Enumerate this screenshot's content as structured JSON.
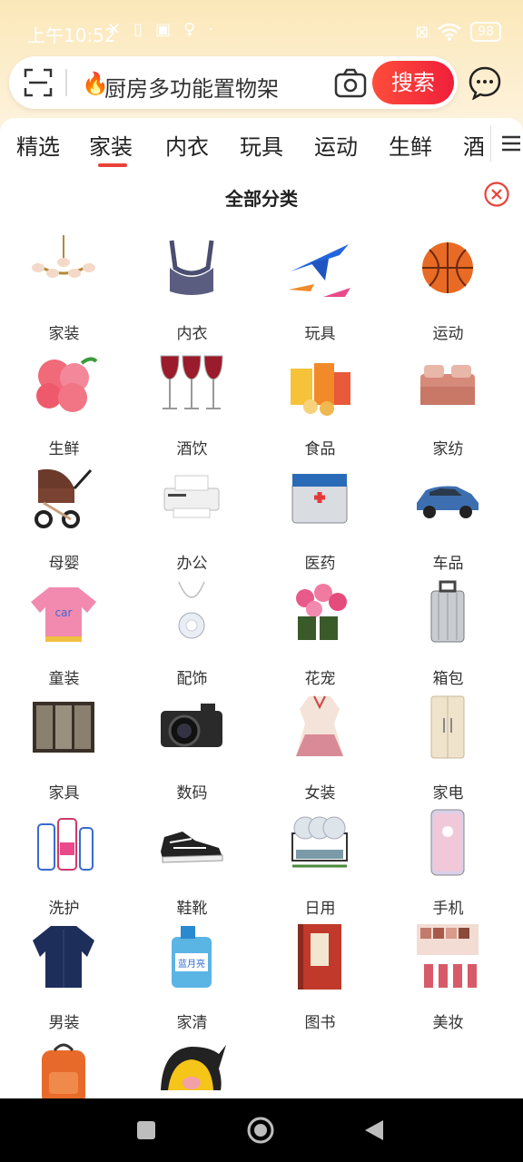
{
  "status": {
    "time": "上午10:52",
    "battery": "98"
  },
  "search": {
    "query": "厨房多功能置物架",
    "button_label": "搜索"
  },
  "tabs": [
    "精选",
    "家装",
    "内衣",
    "玩具",
    "运动",
    "生鲜",
    "酒"
  ],
  "panel": {
    "title": "全部分类"
  },
  "categories": [
    {
      "label": "家装",
      "icon": "chandelier-icon"
    },
    {
      "label": "内衣",
      "icon": "bra-icon"
    },
    {
      "label": "玩具",
      "icon": "toy-plane-icon"
    },
    {
      "label": "运动",
      "icon": "basketball-icon"
    },
    {
      "label": "生鲜",
      "icon": "peach-icon"
    },
    {
      "label": "酒饮",
      "icon": "wine-glass-icon"
    },
    {
      "label": "食品",
      "icon": "snack-icon"
    },
    {
      "label": "家纺",
      "icon": "bed-icon"
    },
    {
      "label": "母婴",
      "icon": "stroller-icon"
    },
    {
      "label": "办公",
      "icon": "printer-icon"
    },
    {
      "label": "医药",
      "icon": "medicine-box-icon"
    },
    {
      "label": "车品",
      "icon": "car-icon"
    },
    {
      "label": "童装",
      "icon": "kids-sweater-icon"
    },
    {
      "label": "配饰",
      "icon": "necklace-icon"
    },
    {
      "label": "花宠",
      "icon": "flower-pot-icon"
    },
    {
      "label": "箱包",
      "icon": "suitcase-icon"
    },
    {
      "label": "家具",
      "icon": "wardrobe-icon"
    },
    {
      "label": "数码",
      "icon": "camera-icon"
    },
    {
      "label": "女装",
      "icon": "dress-icon"
    },
    {
      "label": "家电",
      "icon": "fridge-icon"
    },
    {
      "label": "洗护",
      "icon": "shampoo-icon"
    },
    {
      "label": "鞋靴",
      "icon": "sneaker-icon"
    },
    {
      "label": "日用",
      "icon": "dish-rack-icon"
    },
    {
      "label": "手机",
      "icon": "phone-icon"
    },
    {
      "label": "男装",
      "icon": "shirt-icon"
    },
    {
      "label": "家清",
      "icon": "detergent-icon"
    },
    {
      "label": "图书",
      "icon": "book-icon"
    },
    {
      "label": "美妆",
      "icon": "makeup-palette-icon"
    },
    {
      "label": "",
      "icon": "backpack-icon"
    },
    {
      "label": "",
      "icon": "pig-mascot-icon"
    }
  ],
  "colors": {
    "accent": "#e8423a",
    "search_button": "#ef1f3a",
    "header_bg": "#fbe8b9"
  }
}
